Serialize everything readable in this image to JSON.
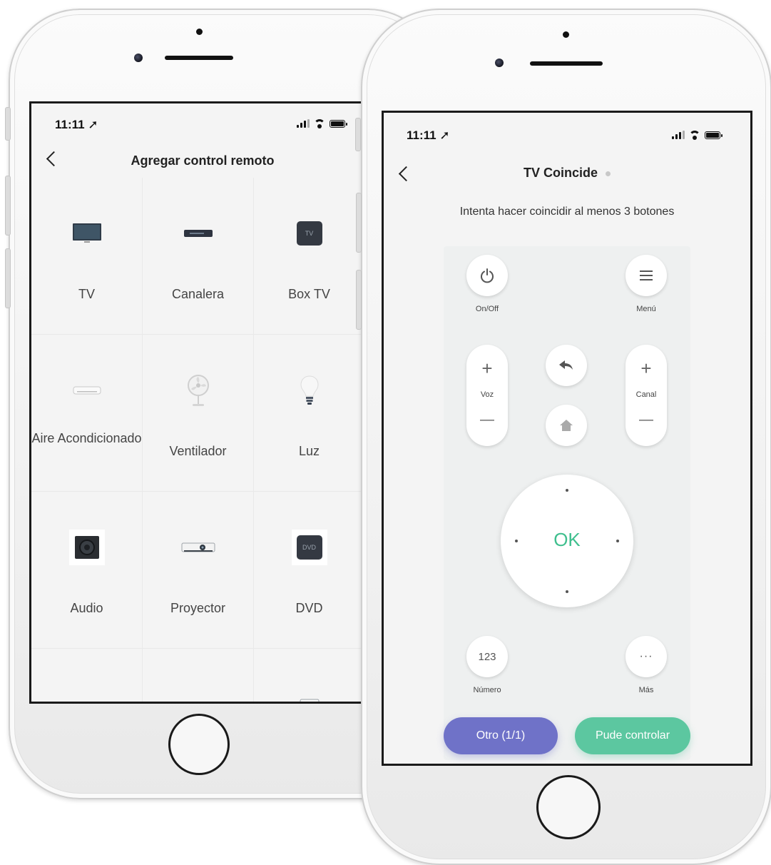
{
  "left_screen": {
    "status": {
      "time": "11:11 ➚"
    },
    "nav": {
      "title": "Agregar control remoto"
    },
    "categories": [
      {
        "label": "TV",
        "icon": "tv-icon"
      },
      {
        "label": "Canalera",
        "icon": "cable-box-icon"
      },
      {
        "label": "Box TV",
        "icon": "box-tv-icon",
        "badge": "TV"
      },
      {
        "label": "Aire Acondicionado",
        "icon": "air-conditioner-icon"
      },
      {
        "label": "Ventilador",
        "icon": "fan-icon"
      },
      {
        "label": "Luz",
        "icon": "light-bulb-icon"
      },
      {
        "label": "Audio",
        "icon": "speaker-icon"
      },
      {
        "label": "Proyector",
        "icon": "projector-icon"
      },
      {
        "label": "DVD",
        "icon": "dvd-icon",
        "badge": "DVD"
      },
      {
        "label": "",
        "icon": "camera-icon"
      },
      {
        "label": "",
        "icon": "device-icon"
      },
      {
        "label": "",
        "icon": "tablet-icon"
      }
    ]
  },
  "right_screen": {
    "status": {
      "time": "11:11 ➚"
    },
    "nav": {
      "title": "TV Coincide"
    },
    "hint": "Intenta hacer coincidir al menos 3 botones",
    "remote": {
      "power_label": "On/Off",
      "menu_label": "Menú",
      "volume_label": "Voz",
      "channel_label": "Canal",
      "plus": "+",
      "minus": "—",
      "ok_label": "OK",
      "number_button": "123",
      "number_label": "Número",
      "more_button": "···",
      "more_label": "Más"
    },
    "actions": {
      "other": "Otro (1/1)",
      "works": "Pude controlar"
    },
    "colors": {
      "accent_green": "#5cc7a0",
      "accent_purple": "#6f72c8"
    }
  }
}
